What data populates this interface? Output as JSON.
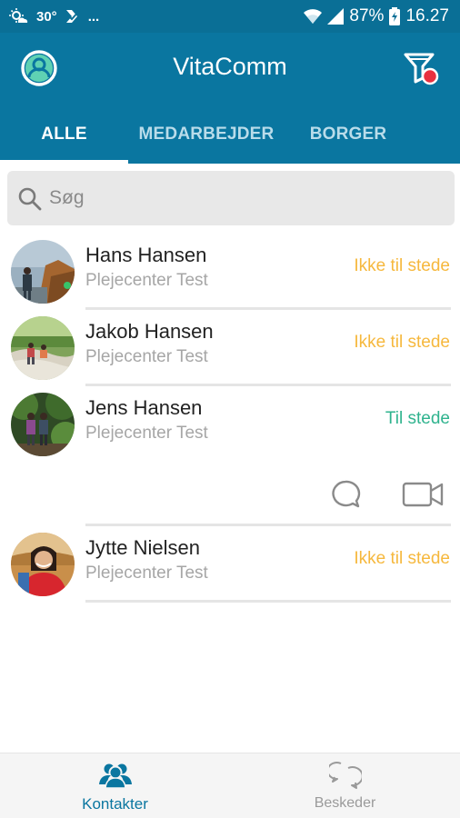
{
  "status_bar": {
    "temperature": "30°",
    "more_indicator": "...",
    "battery": "87%",
    "time": "16.27",
    "icons": [
      "weather-icon",
      "checkmark-notification-icon",
      "wifi-icon",
      "signal-icon",
      "battery-icon"
    ]
  },
  "app_bar": {
    "title": "VitaComm",
    "profile_icon": "profile-icon",
    "filter_icon": "filter-icon"
  },
  "tabs": [
    {
      "label": "ALLE",
      "active": true
    },
    {
      "label": "MEDARBEJDER",
      "active": false
    },
    {
      "label": "BORGER",
      "active": false
    }
  ],
  "search": {
    "placeholder": "Søg",
    "value": ""
  },
  "contacts": [
    {
      "name": "Hans Hansen",
      "organization": "Plejecenter Test",
      "status": "Ikke til stede",
      "status_type": "away"
    },
    {
      "name": "Jakob Hansen",
      "organization": "Plejecenter Test",
      "status": "Ikke til stede",
      "status_type": "away"
    },
    {
      "name": "Jens Hansen",
      "organization": "Plejecenter Test",
      "status": "Til stede",
      "status_type": "present",
      "expanded_actions": [
        "chat-icon",
        "video-call-icon"
      ]
    },
    {
      "name": "Jytte Nielsen",
      "organization": "Plejecenter Test",
      "status": "Ikke til stede",
      "status_type": "away"
    }
  ],
  "bottom_nav": [
    {
      "label": "Kontakter",
      "icon": "contacts-icon",
      "active": true
    },
    {
      "label": "Beskeder",
      "icon": "messages-icon",
      "active": false
    }
  ],
  "colors": {
    "primary": "#0a76a0",
    "status_bar": "#0a6f96",
    "away": "#f6b83d",
    "present": "#2fb38e",
    "notification_dot": "#e8303f"
  }
}
